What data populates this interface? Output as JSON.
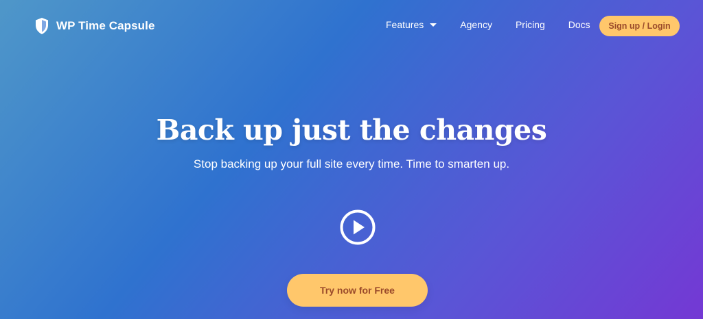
{
  "header": {
    "brand": "WP Time Capsule",
    "nav": [
      {
        "label": "Features",
        "has_dropdown": true
      },
      {
        "label": "Agency"
      },
      {
        "label": "Pricing"
      },
      {
        "label": "Docs"
      }
    ],
    "signup_label": "Sign up / Login"
  },
  "hero": {
    "headline": "Back up just the changes",
    "subline": "Stop backing up your full site every time. Time to smarten up.",
    "play_icon": "play-circle-icon",
    "cta_label": "Try now for Free"
  },
  "colors": {
    "gradient_start": "#4f97c9",
    "gradient_mid": "#2f72cf",
    "gradient_end": "#7438d4",
    "button_bg": "#ffc76b",
    "button_text": "#9a4a2a",
    "text": "#ffffff"
  },
  "icons": {
    "logo": "shield-icon",
    "dropdown": "caret-down-icon"
  }
}
